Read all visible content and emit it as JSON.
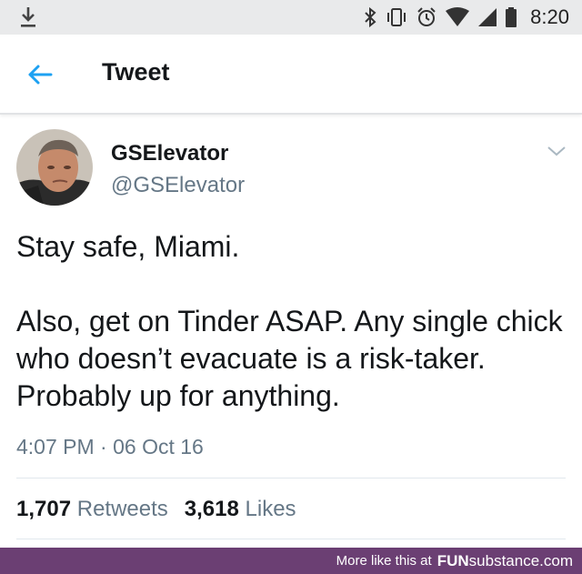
{
  "status_bar": {
    "time": "8:20",
    "icons": [
      "download-icon",
      "bluetooth-icon",
      "vibrate-icon",
      "alarm-icon",
      "wifi-icon",
      "signal-icon",
      "battery-icon"
    ]
  },
  "app_bar": {
    "title": "Tweet",
    "back_icon": "arrow-left-icon"
  },
  "tweet": {
    "display_name": "GSElevator",
    "handle": "@GSElevator",
    "text_line1": "Stay safe, Miami.",
    "text_line2": "Also, get on Tinder ASAP. Any single chick who doesn’t evacuate is a risk-taker. Probably up for anything.",
    "timestamp": "4:07 PM · 06 Oct 16",
    "retweets_count": "1,707",
    "retweets_label": "Retweets",
    "likes_count": "3,618",
    "likes_label": "Likes"
  },
  "footer": {
    "text": "More like this at",
    "brand_bold": "FUN",
    "brand_rest": "substance.com"
  },
  "colors": {
    "accent": "#1da1f2",
    "secondary_text": "#657786",
    "footer_bg": "#6b3f73"
  }
}
